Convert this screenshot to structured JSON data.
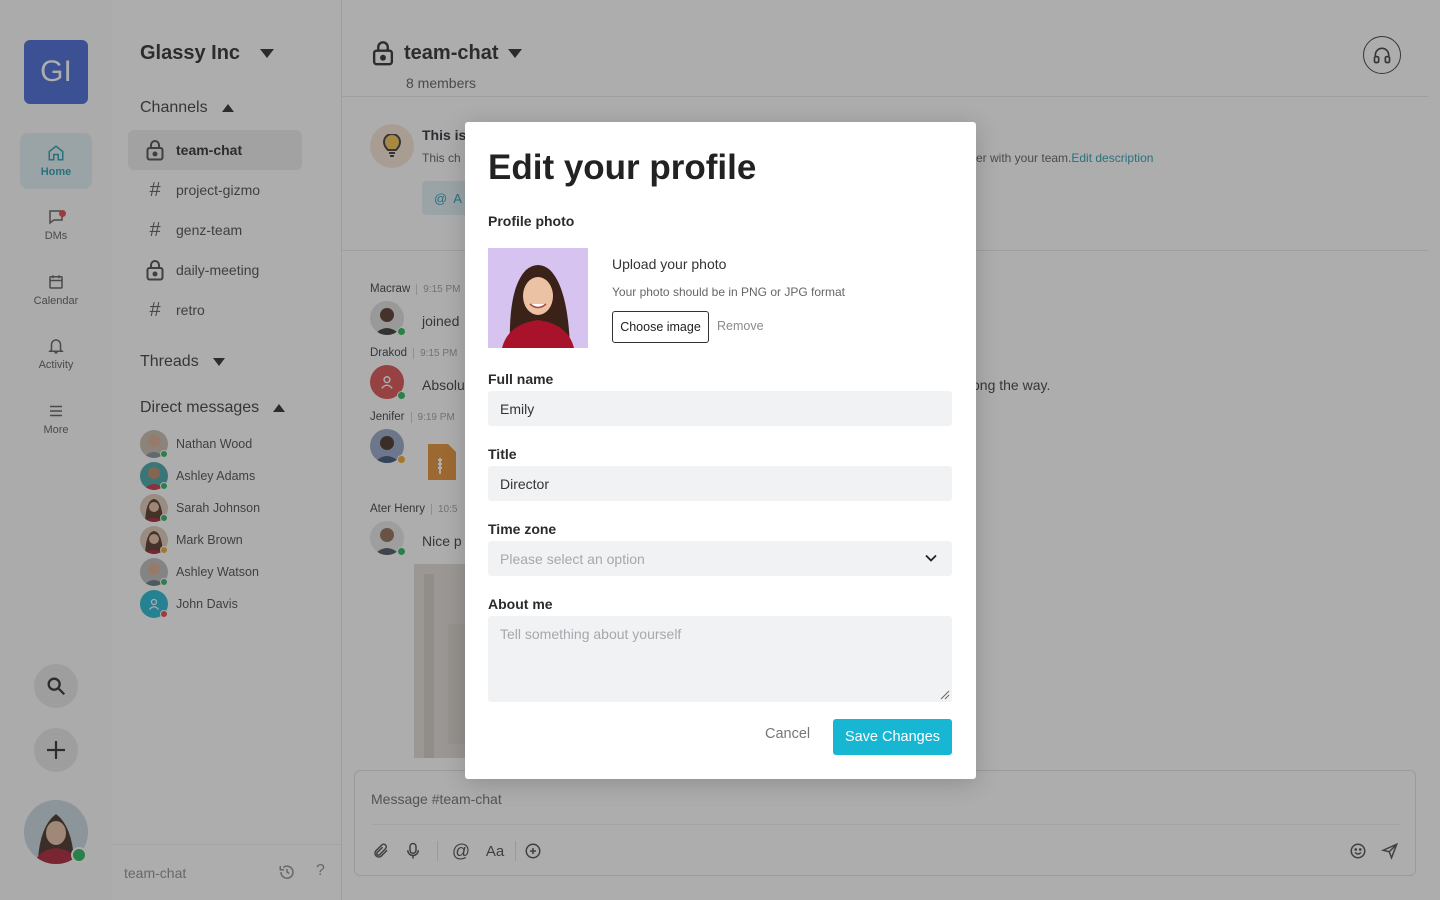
{
  "workspace": {
    "initials": "GI",
    "name": "Glassy Inc"
  },
  "rail": {
    "items": [
      {
        "label": "Home",
        "icon": "home-icon"
      },
      {
        "label": "DMs",
        "icon": "chat-icon"
      },
      {
        "label": "Calendar",
        "icon": "calendar-icon"
      },
      {
        "label": "Activity",
        "icon": "bell-icon"
      },
      {
        "label": "More",
        "icon": "menu-icon"
      }
    ]
  },
  "sidebar": {
    "channels_title": "Channels",
    "channels": [
      {
        "name": "team-chat",
        "type": "private"
      },
      {
        "name": "project-gizmo",
        "type": "public"
      },
      {
        "name": "genz-team",
        "type": "public"
      },
      {
        "name": "daily-meeting",
        "type": "private"
      },
      {
        "name": "retro",
        "type": "public"
      }
    ],
    "threads_title": "Threads",
    "dms_title": "Direct messages",
    "dms": [
      {
        "name": "Nathan Wood",
        "status": "#1fb155"
      },
      {
        "name": "Ashley Adams",
        "status": "#1fb155"
      },
      {
        "name": "Sarah Johnson",
        "status": "#1fb155"
      },
      {
        "name": "Mark Brown",
        "status": "#f0a020"
      },
      {
        "name": "Ashley Watson",
        "status": "#1fb155"
      },
      {
        "name": "John Davis",
        "status": "#e23b3b"
      }
    ],
    "footer": "team-chat"
  },
  "channel": {
    "title": "team-chat",
    "members": "8 members",
    "intro_title": "This is",
    "intro_text": "This ch",
    "intro_tail": "er with your team.",
    "edit_description": "Edit description",
    "intro_button": "A"
  },
  "messages": [
    {
      "author": "Macraw",
      "time": "9:15 PM",
      "text": "joined"
    },
    {
      "author": "Drakod",
      "time": "9:15 PM",
      "text": "Absolu",
      "tail": "ong the way."
    },
    {
      "author": "Jenifer",
      "time": "9:19 PM",
      "text": ""
    },
    {
      "author": "Ater Henry",
      "time": "10:5",
      "text": "Nice p"
    }
  ],
  "composer": {
    "placeholder": "Message #team-chat"
  },
  "modal": {
    "title": "Edit your profile",
    "photo_label": "Profile photo",
    "upload_title": "Upload your photo",
    "upload_hint": "Your photo should be in PNG or JPG format",
    "choose_label": "Choose image",
    "remove_label": "Remove",
    "full_name_label": "Full name",
    "full_name_value": "Emily",
    "title_label": "Title",
    "title_value": "Director",
    "timezone_label": "Time zone",
    "timezone_placeholder": "Please select an option",
    "about_label": "About me",
    "about_placeholder": "Tell something about yourself",
    "cancel_label": "Cancel",
    "save_label": "Save Changes"
  },
  "colors": {
    "accent": "#17b6d3",
    "workspace": "#3d5fd4",
    "online": "#1fb155"
  }
}
